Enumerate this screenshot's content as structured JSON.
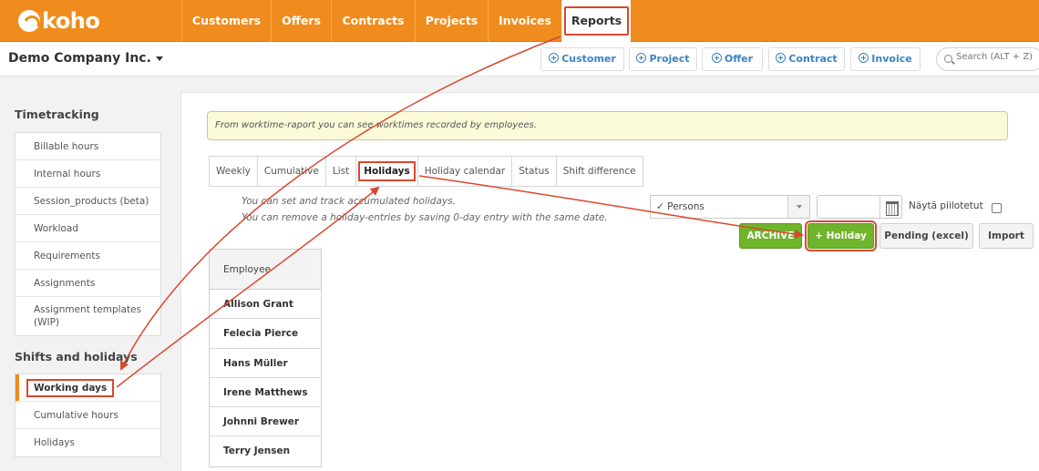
{
  "brand": {
    "name": "koho"
  },
  "nav": {
    "items": [
      {
        "label": "Customers"
      },
      {
        "label": "Offers"
      },
      {
        "label": "Contracts"
      },
      {
        "label": "Projects"
      },
      {
        "label": "Invoices"
      },
      {
        "label": "Reports"
      }
    ],
    "active": "Reports"
  },
  "subheader": {
    "company": "Demo Company Inc.",
    "quick_actions": [
      {
        "label": "Customer"
      },
      {
        "label": "Project"
      },
      {
        "label": "Offer"
      },
      {
        "label": "Contract"
      },
      {
        "label": "Invoice"
      }
    ],
    "search_placeholder": "Search (ALT + Z)"
  },
  "sidebar": {
    "timetracking": {
      "title": "Timetracking",
      "items": [
        {
          "label": "Billable hours"
        },
        {
          "label": "Internal hours"
        },
        {
          "label": "Session_products (beta)"
        },
        {
          "label": "Workload"
        },
        {
          "label": "Requirements"
        },
        {
          "label": "Assignments"
        },
        {
          "label": "Assignment templates (WIP)"
        }
      ]
    },
    "shifts": {
      "title": "Shifts and holidays",
      "items": [
        {
          "label": "Working days"
        },
        {
          "label": "Cumulative hours"
        },
        {
          "label": "Holidays"
        }
      ],
      "active": "Working days"
    }
  },
  "main": {
    "info": "From worktime-raport you can see worktimes recorded by employees.",
    "tabs": [
      {
        "label": "Weekly"
      },
      {
        "label": "Cumulative"
      },
      {
        "label": "List"
      },
      {
        "label": "Holidays"
      },
      {
        "label": "Holiday calendar"
      },
      {
        "label": "Status"
      },
      {
        "label": "Shift difference"
      }
    ],
    "active_tab": "Holidays",
    "help_lines": [
      "You can set and track accumulated holidays.",
      "You can remove a holiday-entries by saving 0-day entry with the same date."
    ],
    "filters": {
      "persons_select": "✓ Persons",
      "date_value": "",
      "show_hidden_label": "Näytä piilotetut",
      "show_hidden_checked": false
    },
    "buttons": {
      "archive": "ARCHIVE",
      "add_holiday": "+ Holiday",
      "pending": "Pending (excel)",
      "import": "Import"
    },
    "table": {
      "header": "Employee",
      "rows": [
        "Allison Grant",
        "Felecia Pierce",
        "Hans Müller",
        "Irene Matthews",
        "Johnni Brewer",
        "Terry Jensen"
      ]
    }
  },
  "colors": {
    "brand_orange": "#f08c1e",
    "annotation_red": "#d9482e",
    "accent_blue": "#3b83c4",
    "button_green": "#6fb52c"
  }
}
